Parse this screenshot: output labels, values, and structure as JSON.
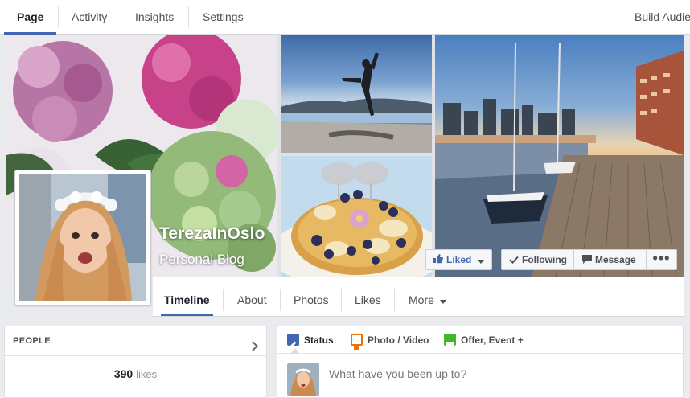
{
  "admin_nav": {
    "tabs": [
      "Page",
      "Activity",
      "Insights",
      "Settings"
    ],
    "right_link": "Build Audie"
  },
  "page": {
    "name": "TerezaInOslo",
    "category": "Personal Blog"
  },
  "cover_actions": {
    "liked": "Liked",
    "following": "Following",
    "message": "Message",
    "more": "•••"
  },
  "timeline_tabs": {
    "tabs": [
      "Timeline",
      "About",
      "Photos",
      "Likes"
    ],
    "more": "More"
  },
  "people": {
    "heading": "PEOPLE",
    "likes_count": "390",
    "likes_word": "likes"
  },
  "composer": {
    "status": "Status",
    "photo_video": "Photo / Video",
    "offer_event": "Offer, Event +",
    "placeholder": "What have you been up to?"
  },
  "colors": {
    "accent": "#4267b2",
    "status_icon": "#4267b2",
    "photo_icon": "#e9710f",
    "offer_icon": "#42b72a"
  },
  "icons": [
    "thumbs-up-icon",
    "caret-down-icon",
    "checkmark-icon",
    "message-icon",
    "more-dots-icon",
    "chevron-right-icon",
    "pencil-icon",
    "camera-icon",
    "gift-icon"
  ]
}
